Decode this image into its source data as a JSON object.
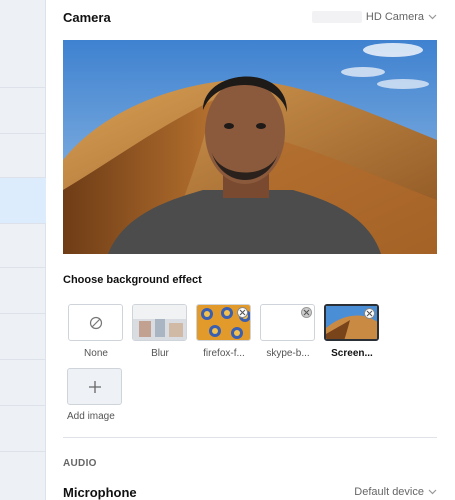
{
  "camera": {
    "title": "Camera",
    "device_suffix": "HD Camera"
  },
  "background_effects": {
    "title": "Choose background effect",
    "options": [
      {
        "label": "None",
        "selected": false
      },
      {
        "label": "Blur",
        "selected": false
      },
      {
        "label": "firefox-f...",
        "selected": false
      },
      {
        "label": "skype-b...",
        "selected": false
      },
      {
        "label": "Screen...",
        "selected": true
      }
    ],
    "add_label": "Add image"
  },
  "audio": {
    "section_label": "AUDIO",
    "microphone_title": "Microphone",
    "microphone_device": "Default device"
  },
  "colors": {
    "active_nav": "#dcecfd",
    "sky": "#4a8ed6",
    "dune": "#c98a43"
  },
  "icons": [
    "none-icon",
    "close-icon",
    "plus-icon",
    "chevron-down-icon"
  ]
}
